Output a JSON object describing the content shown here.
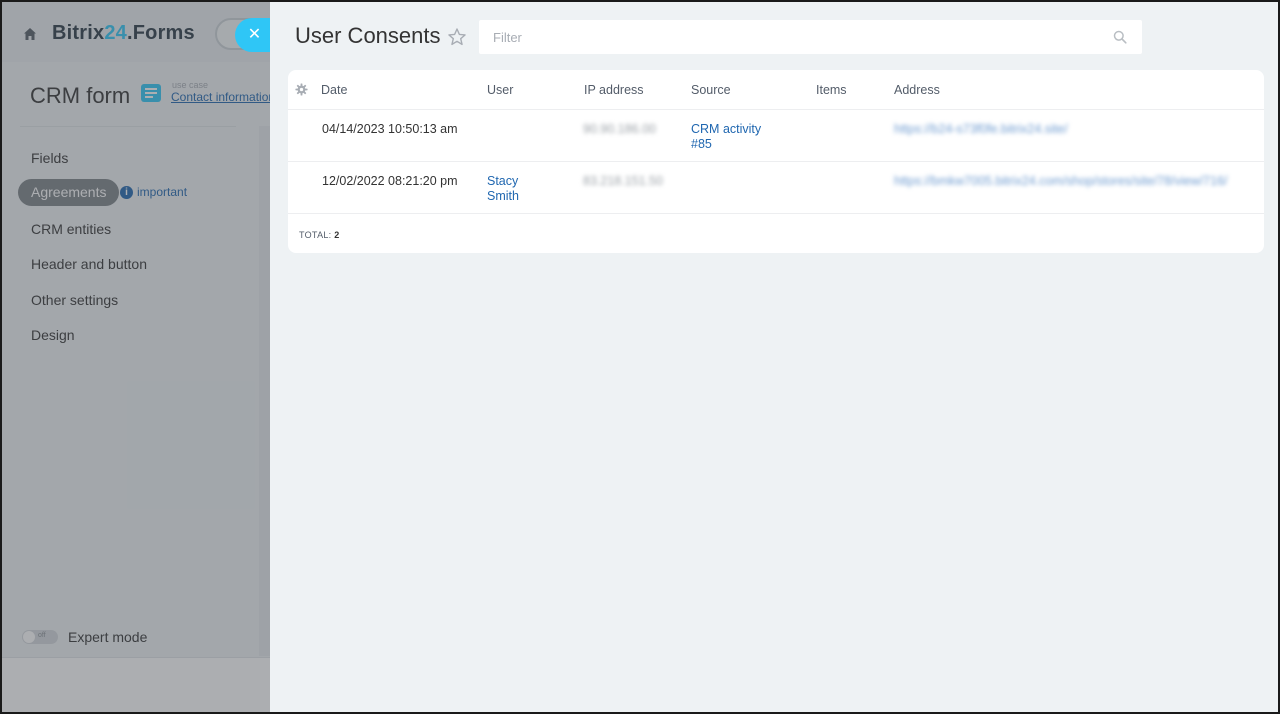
{
  "app": {
    "logo_part1": "Bitrix",
    "logo_part2": "24",
    "logo_part3": ".Forms"
  },
  "form": {
    "title": "CRM form",
    "use_case_label": "use case",
    "use_case_link": "Contact information"
  },
  "sidebar": {
    "items": [
      {
        "label": "Fields"
      },
      {
        "label": "Agreements"
      },
      {
        "label": "CRM entities"
      },
      {
        "label": "Header and button"
      },
      {
        "label": "Other settings"
      },
      {
        "label": "Design"
      }
    ],
    "active_index": 1,
    "important_label": "important",
    "expert_mode_label": "Expert mode",
    "expert_toggle_state": "off"
  },
  "panel": {
    "title": "User Consents",
    "filter_placeholder": "Filter",
    "columns": [
      "Date",
      "User",
      "IP address",
      "Source",
      "Items",
      "Address"
    ],
    "rows": [
      {
        "date": "04/14/2023 10:50:13 am",
        "user": "",
        "ip": "90.90.186.00",
        "source": "CRM activity #85",
        "items": "",
        "address": "https://b24-s73f0fe.bitrix24.site/"
      },
      {
        "date": "12/02/2022 08:21:20 pm",
        "user": "Stacy Smith",
        "ip": "83.218.151.50",
        "source": "",
        "items": "",
        "address": "https://bmkw7005.bitrix24.com/shop/stores/site/78/view/716/"
      }
    ],
    "total_label": "TOTAL:",
    "total_value": "2"
  },
  "colors": {
    "accent": "#2fc6f6",
    "link": "#2067b0",
    "active_nav": "#7d8388"
  }
}
